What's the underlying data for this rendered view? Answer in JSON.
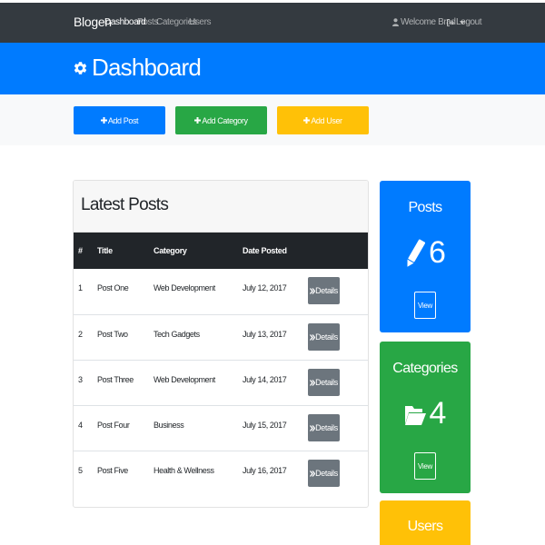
{
  "navbar": {
    "brand": "Blogen",
    "links": [
      {
        "label": "Dashboard",
        "active": true
      },
      {
        "label": "Posts"
      },
      {
        "label": "Categories"
      },
      {
        "label": "Users"
      }
    ],
    "user_label": "Welcome Brad",
    "logout_label": "Logout"
  },
  "header": {
    "title": "Dashboard"
  },
  "actions": {
    "add_post": "Add Post",
    "add_category": "Add Category",
    "add_user": "Add User"
  },
  "posts_table": {
    "title": "Latest Posts",
    "columns": [
      "#",
      "Title",
      "Category",
      "Date Posted"
    ],
    "rows": [
      {
        "num": "1",
        "title": "Post One",
        "category": "Web Development",
        "date": "July 12, 2017",
        "button": "Details"
      },
      {
        "num": "2",
        "title": "Post Two",
        "category": "Tech Gadgets",
        "date": "July 13, 2017",
        "button": "Details"
      },
      {
        "num": "3",
        "title": "Post Three",
        "category": "Web Development",
        "date": "July 14, 2017",
        "button": "Details"
      },
      {
        "num": "4",
        "title": "Post Four",
        "category": "Business",
        "date": "July 15, 2017",
        "button": "Details"
      },
      {
        "num": "5",
        "title": "Post Five",
        "category": "Health & Wellness",
        "date": "July 16, 2017",
        "button": "Details"
      }
    ]
  },
  "stats": {
    "posts": {
      "title": "Posts",
      "count": "6",
      "view": "View"
    },
    "categories": {
      "title": "Categories",
      "count": "4",
      "view": "View"
    },
    "users": {
      "title": "Users"
    }
  },
  "colors": {
    "primary": "#007bff",
    "success": "#28a745",
    "warning": "#ffc107",
    "dark": "#343a40",
    "secondary": "#6c757d"
  },
  "icons": [
    "user-icon",
    "caret-down-icon",
    "logout-icon",
    "gear-icon",
    "plus-icon",
    "double-chevron-right-icon",
    "pencil-icon",
    "folder-open-icon"
  ]
}
